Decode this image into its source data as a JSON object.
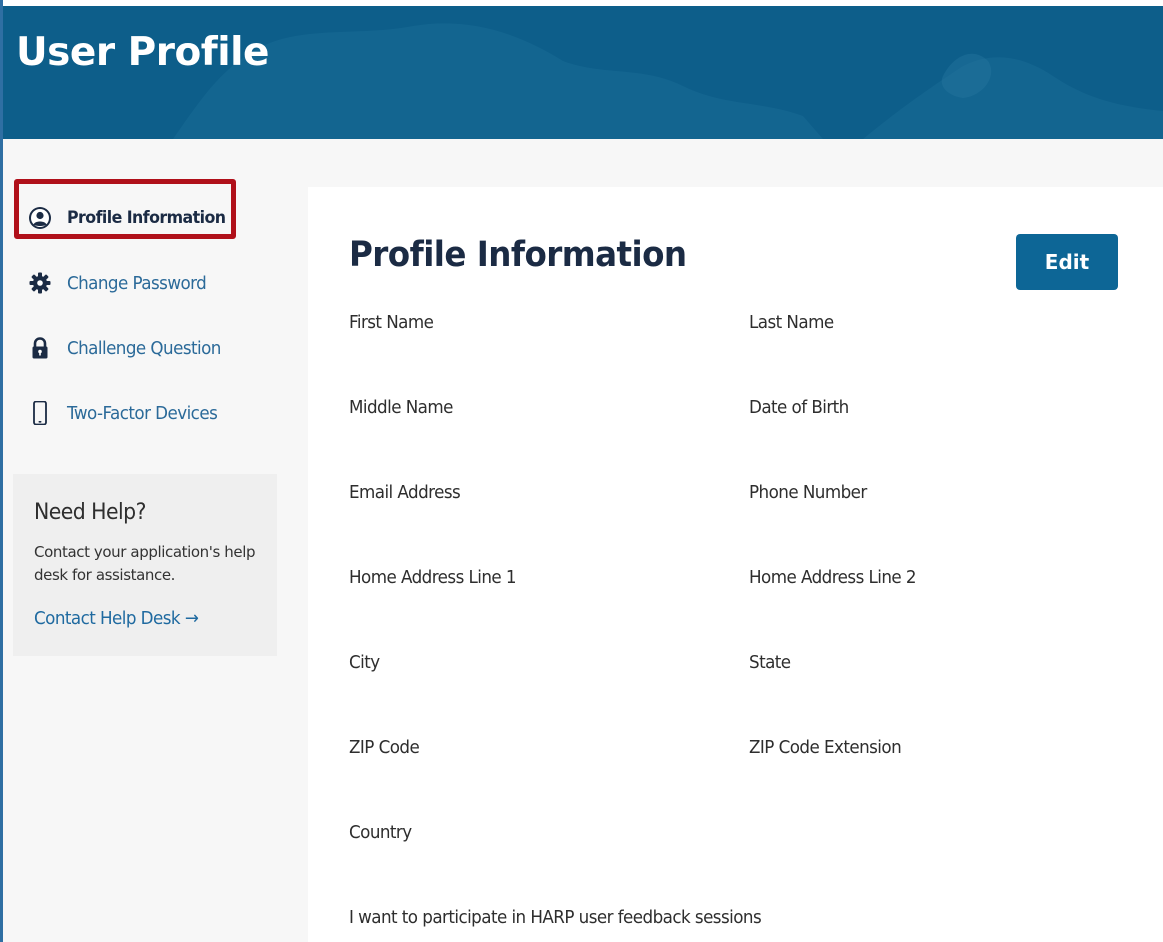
{
  "header": {
    "title": "User Profile"
  },
  "sidebar": {
    "items": [
      {
        "label": "Profile Information",
        "icon": "user-circle-icon",
        "active": true
      },
      {
        "label": "Change Password",
        "icon": "gear-icon",
        "active": false
      },
      {
        "label": "Challenge Question",
        "icon": "lock-icon",
        "active": false
      },
      {
        "label": "Two-Factor Devices",
        "icon": "mobile-phone-icon",
        "active": false
      }
    ],
    "help": {
      "title": "Need Help?",
      "text": "Contact your application's help desk for assistance.",
      "link_label": "Contact Help Desk →"
    }
  },
  "main": {
    "title": "Profile Information",
    "edit_label": "Edit",
    "fields": {
      "first_name": "First Name",
      "last_name": "Last Name",
      "middle_name": "Middle Name",
      "date_of_birth": "Date of Birth",
      "email_address": "Email Address",
      "phone_number": "Phone Number",
      "home_address_1": "Home Address Line 1",
      "home_address_2": "Home Address Line 2",
      "city": "City",
      "state": "State",
      "zip_code": "ZIP Code",
      "zip_code_extension": "ZIP Code Extension",
      "country": "Country",
      "feedback_sessions": "I want to participate in HARP user feedback sessions"
    }
  },
  "colors": {
    "banner": "#0d5e8a",
    "accent": "#0d6696",
    "link": "#2b6a99",
    "highlight": "#b0101a",
    "heading": "#1b2b44"
  }
}
